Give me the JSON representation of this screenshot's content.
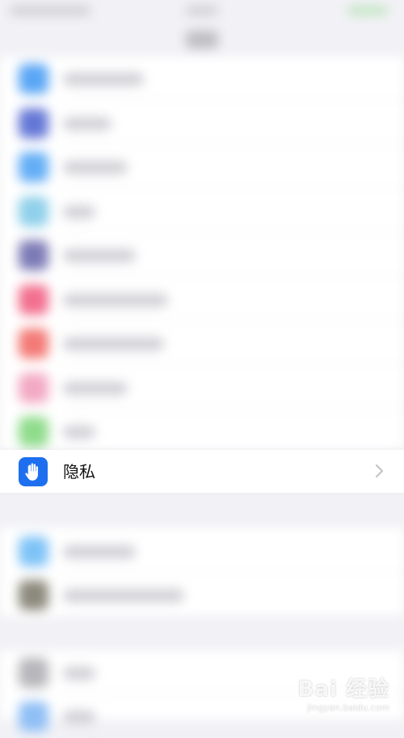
{
  "status_bar": {},
  "settings_list": {
    "blurred_rows_group1": [
      {
        "icon_color": "#5aa6f5"
      },
      {
        "icon_color": "#6477d6"
      },
      {
        "icon_color": "#64aef6"
      },
      {
        "icon_color": "#8fd0ea"
      },
      {
        "icon_color": "#7d7bb6"
      },
      {
        "icon_color": "#f2708f"
      },
      {
        "icon_color": "#f37a76"
      },
      {
        "icon_color": "#f3a9c3"
      },
      {
        "icon_color": "#8fdc8b"
      }
    ],
    "privacy_row": {
      "label": "隐私",
      "icon": "hand-raised-icon",
      "icon_color": "#1e6ff0"
    },
    "blurred_rows_group2": [
      {
        "icon_color": "#7ec3f7"
      },
      {
        "icon_color": "#8c8a7c"
      }
    ],
    "blurred_rows_group3": [
      {
        "icon_color": "#b7b7bb"
      },
      {
        "icon_color": "#8fbff5"
      }
    ]
  },
  "watermark": {
    "brand": "Bai 经验",
    "url": "jingyan.baidu.com"
  }
}
